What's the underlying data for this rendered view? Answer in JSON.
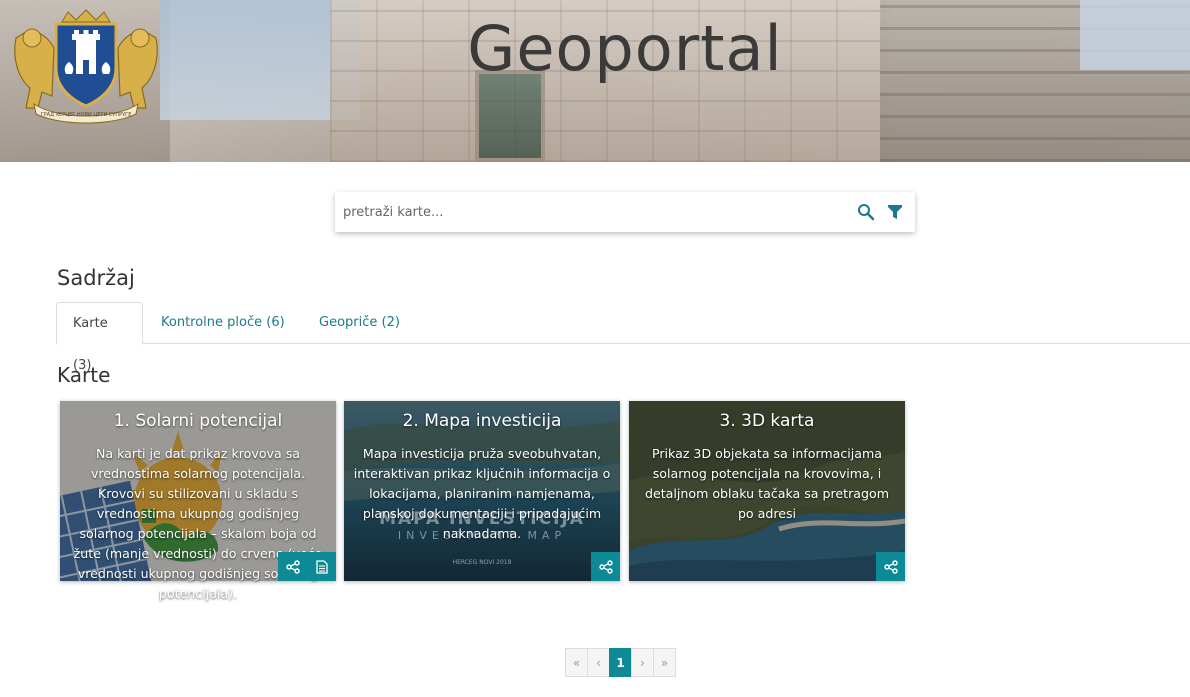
{
  "header": {
    "title": "Geoportal",
    "crest_text": "ГРАД ХЕРЦЕГ НОВИ ЦЕТИ СУПРУГЕ"
  },
  "search": {
    "placeholder": "pretraži karte..."
  },
  "content": {
    "title": "Sadržaj",
    "tabs": [
      {
        "label": "Karte (3)",
        "active": true
      },
      {
        "label": "Kontrolne ploče (6)",
        "active": false
      },
      {
        "label": "Geopriče (2)",
        "active": false
      }
    ],
    "section_title": "Karte",
    "cards": [
      {
        "title": "1. Solarni potencijal",
        "description": "Na karti je dat prikaz krovova sa vrednostima solarnog potencijala. Krovovi su stilizovani u skladu s vrednostima ukupnog godišnjeg solarnog potencijala – skalom boja od žute (manje vrednosti) do crvene (veće vrednosti ukupnog godišnjeg solarnog potencijala).",
        "buttons": [
          "share-icon",
          "document-icon"
        ]
      },
      {
        "title": "2. Mapa investicija",
        "description": "Mapa investicija pruža sveobuhvatan, interaktivan prikaz ključnih informacija o lokacijama, planiranim namjenama, planskoj dokumentaciji i pripadajućim naknadama.",
        "bg_text_1": "MAPA INVESTICIJA",
        "bg_text_2": "INVESTMENT MAP",
        "bg_text_3": "HERCEG NOVI 2018",
        "buttons": [
          "share-icon"
        ]
      },
      {
        "title": "3. 3D karta",
        "description": "Prikaz 3D objekata sa informacijama solarnog potencijala na krovovima, i detaljnom oblaku tačaka sa pretragom po adresi",
        "buttons": [
          "share-icon"
        ]
      }
    ]
  },
  "pagination": {
    "first": "«",
    "prev": "‹",
    "current": "1",
    "next": "›",
    "last": "»"
  },
  "colors": {
    "accent": "#0e8a96",
    "tab_link": "#1b7a8c"
  }
}
